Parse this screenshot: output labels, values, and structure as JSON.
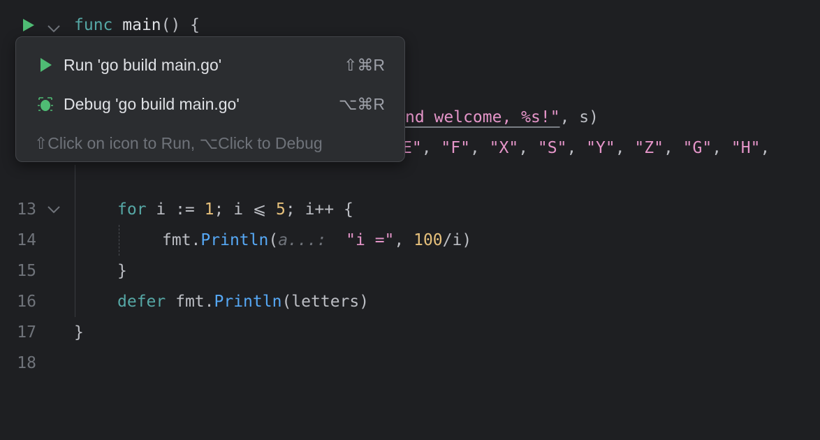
{
  "editor": {
    "lines": {
      "l10": {
        "kw": "func",
        "fn": "main",
        "rest": "() {"
      },
      "l12": {
        "s1": "E\"",
        "s2": "\"F\"",
        "s3": "\"X\"",
        "s4": "\"S\"",
        "s5": "\"Y\"",
        "s6": "\"Z\"",
        "s7": "\"G\"",
        "s8": "\"H\"",
        "sep": ", "
      },
      "l11": {
        "str": "nd welcome, %s!\"",
        "rest": ", s)"
      },
      "l13": {
        "num": "13"
      },
      "l14": {
        "num": "14",
        "kw": "for",
        "a": " i := ",
        "n1": "1",
        "b": "; i ⩽ ",
        "n2": "5",
        "c": "; i++ {"
      },
      "l15": {
        "num": "15",
        "pkg": "fmt",
        "dot": ".",
        "fn": "Println",
        "open": "(",
        "hint": "a...:",
        "str": "\"i =\"",
        "comma": ", ",
        "n": "100",
        "rest": "/i)"
      },
      "l16": {
        "num": "16",
        "text": "}"
      },
      "l17": {
        "num": "17",
        "kw": "defer",
        "pkg": "fmt",
        "dot": ".",
        "fn": "Println",
        "rest": "(letters)"
      },
      "l18": {
        "num": "18",
        "text": "}"
      }
    }
  },
  "popup": {
    "run_label": "Run 'go build main.go'",
    "run_shortcut": "⇧⌘R",
    "debug_label": "Debug 'go build main.go'",
    "debug_shortcut": "⌥⌘R",
    "hint": "⇧Click on icon to Run, ⌥Click to Debug"
  },
  "colors": {
    "run_icon": "#4fbc74",
    "background": "#1e1f22",
    "popup_background": "#2b2d30"
  }
}
